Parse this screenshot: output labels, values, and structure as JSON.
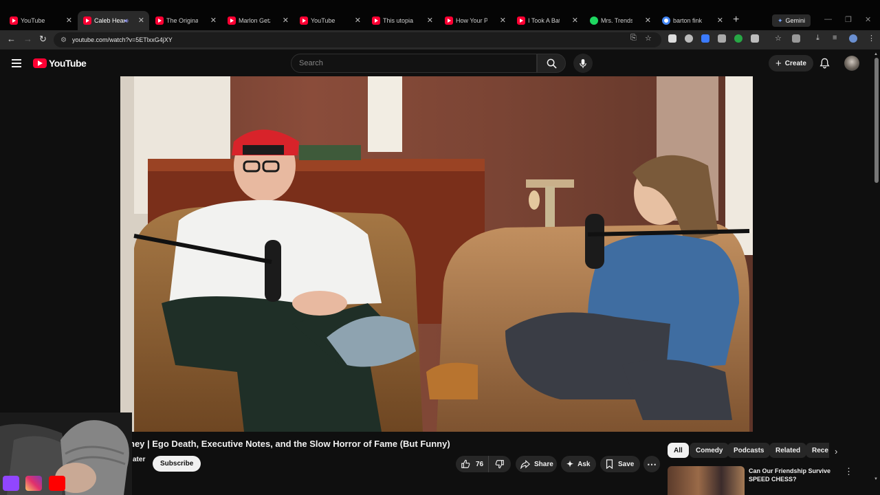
{
  "browser": {
    "tabs": [
      {
        "title": "YouTube",
        "favicon": "youtube-icon",
        "active": false
      },
      {
        "title": "Caleb Hearon",
        "favicon": "youtube-icon",
        "active": true,
        "audio": true
      },
      {
        "title": "The Original",
        "favicon": "youtube-icon",
        "active": false
      },
      {
        "title": "Marlon Getz",
        "favicon": "youtube-icon",
        "active": false
      },
      {
        "title": "YouTube",
        "favicon": "youtube-icon",
        "active": false
      },
      {
        "title": "This utopia",
        "favicon": "youtube-icon",
        "active": false
      },
      {
        "title": "How Your Pe",
        "favicon": "youtube-icon",
        "active": false
      },
      {
        "title": "I Took A Bat",
        "favicon": "youtube-icon",
        "active": false
      },
      {
        "title": "Mrs. Trendse",
        "favicon": "spotify-icon",
        "active": false
      },
      {
        "title": "barton fink",
        "favicon": "google-icon",
        "active": false
      }
    ],
    "gemini_label": "Gemini",
    "url": "youtube.com/watch?v=5ETlxxG4jXY"
  },
  "youtube": {
    "logo_text": "YouTube",
    "search_placeholder": "Search",
    "create_label": "Create",
    "video": {
      "title": "ney | Ego Death, Executive Notes, and the Slow Horror of Fame (But Funny)",
      "channel": "ater",
      "subscribe_label": "Subscribe",
      "likes": "76",
      "share_label": "Share",
      "ask_label": "Ask",
      "save_label": "Save"
    },
    "chips": [
      "All",
      "Comedy",
      "Podcasts",
      "Related",
      "Rece"
    ],
    "recommendation": {
      "title": "Can Our Friendship Survive SPEED CHESS?"
    }
  },
  "colors": {
    "background": "#0f0f0f",
    "brand_red": "#ff0033",
    "chip_active": "#f1f1f1"
  },
  "overlay": {
    "social_icons": [
      "twitch-icon",
      "instagram-icon",
      "youtube-icon"
    ]
  }
}
